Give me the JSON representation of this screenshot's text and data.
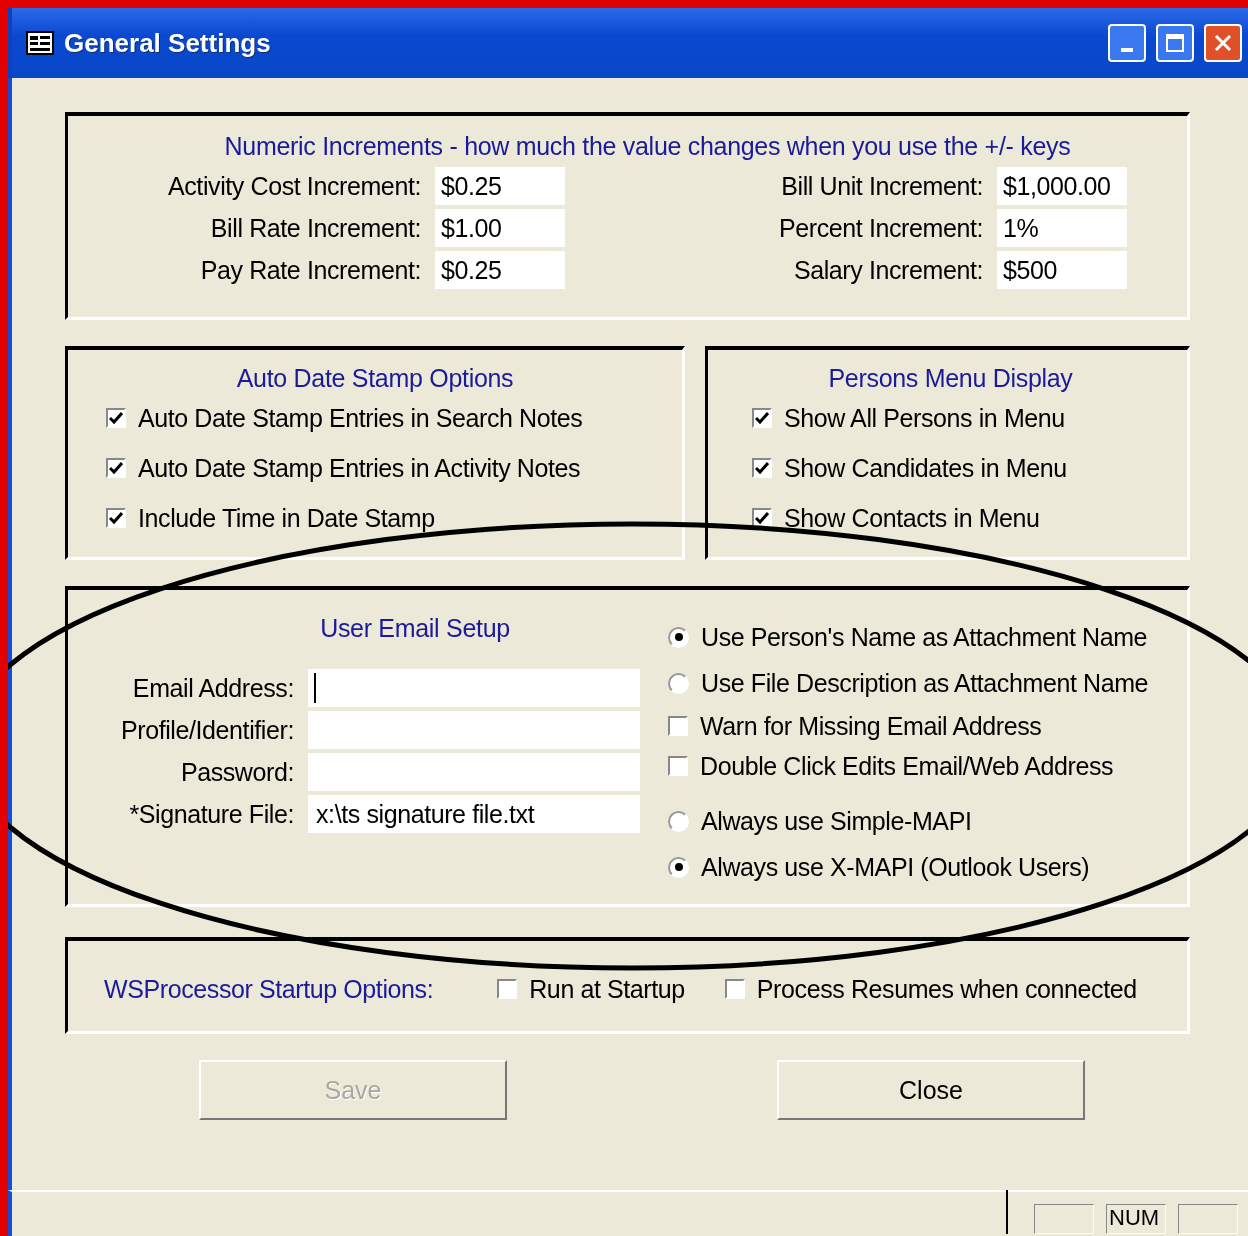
{
  "window": {
    "title": "General Settings"
  },
  "numeric_increments": {
    "title": "Numeric Increments - how much the value changes when you use the +/- keys",
    "left_fields": [
      {
        "label": "Activity Cost Increment:",
        "value": "$0.25"
      },
      {
        "label": "Bill Rate Increment:",
        "value": "$1.00"
      },
      {
        "label": "Pay Rate Increment:",
        "value": "$0.25"
      }
    ],
    "right_fields": [
      {
        "label": "Bill Unit Increment:",
        "value": "$1,000.00"
      },
      {
        "label": "Percent Increment:",
        "value": "1%"
      },
      {
        "label": "Salary Increment:",
        "value": "$500"
      }
    ]
  },
  "auto_date_stamp": {
    "title": "Auto Date Stamp Options",
    "options": [
      {
        "label": "Auto Date Stamp Entries in Search Notes",
        "checked": true
      },
      {
        "label": "Auto Date Stamp Entries in Activity Notes",
        "checked": true
      },
      {
        "label": "Include Time in Date Stamp",
        "checked": true
      }
    ]
  },
  "persons_menu": {
    "title": "Persons Menu Display",
    "options": [
      {
        "label": "Show All Persons in Menu",
        "checked": true
      },
      {
        "label": "Show Candidates in Menu",
        "checked": true
      },
      {
        "label": "Show Contacts in Menu",
        "checked": true
      }
    ]
  },
  "email_setup": {
    "title": "User Email Setup",
    "fields": [
      {
        "label": "Email Address:",
        "focused": true
      },
      {
        "label": "Profile/Identifier:",
        "focused": false
      },
      {
        "label": "Password:",
        "focused": false
      },
      {
        "label": "*Signature File:",
        "value": "x:\\ts signature file.txt",
        "focused": false
      }
    ],
    "attachment_options": [
      {
        "label": "Use Person's Name as Attachment Name",
        "selected": true
      },
      {
        "label": "Use File Description as Attachment Name",
        "selected": false
      }
    ],
    "checkboxes": [
      {
        "label": "Warn for Missing Email Address",
        "checked": false
      },
      {
        "label": "Double Click Edits Email/Web Address",
        "checked": false
      }
    ],
    "mapi_options": [
      {
        "label": "Always use Simple-MAPI",
        "selected": false
      },
      {
        "label": "Always use X-MAPI (Outlook Users)",
        "selected": true
      }
    ]
  },
  "startup": {
    "title": "WSProcessor Startup Options:",
    "options": [
      {
        "label": "Run at Startup",
        "checked": false
      },
      {
        "label": "Process Resumes when connected",
        "checked": false
      }
    ]
  },
  "buttons": [
    {
      "label": "Save",
      "disabled": true
    },
    {
      "label": "Close",
      "disabled": false
    }
  ],
  "status_bar": {
    "indicator": "NUM"
  }
}
